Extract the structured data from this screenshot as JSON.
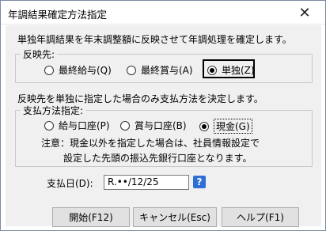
{
  "window": {
    "title": "年調結果確定方法指定",
    "close_glyph": "✕"
  },
  "intro_text": "単独年調結果を年末調整額に反映させて年調処理を確定します。",
  "reflect_group": {
    "legend": "反映先:",
    "options": [
      {
        "label": "最終給与(Q)",
        "selected": false
      },
      {
        "label": "最終賞与(A)",
        "selected": false
      },
      {
        "label": "単独(Z)",
        "selected": true
      }
    ]
  },
  "payment_intro": "反映先を単独に指定した場合のみ支払方法を決定します。",
  "payment_group": {
    "legend": "支払方法指定:",
    "options": [
      {
        "label": "給与口座(P)",
        "selected": false
      },
      {
        "label": "賞与口座(B)",
        "selected": false
      },
      {
        "label": "現金(G)",
        "selected": true
      }
    ],
    "note_line1": "注意：現金以外を指定した場合は、社員情報設定で",
    "note_line2": "設定した先頭の振込先銀行口座となります。"
  },
  "payment_date": {
    "label": "支払日(D):",
    "value": "R.••/12/25",
    "help_glyph": "?"
  },
  "buttons": {
    "start": "開始(F12)",
    "cancel": "キャンセル(Esc)",
    "help": "ヘルプ(F1)"
  },
  "colors": {
    "accent": "#2d6fd6",
    "dialog_bg": "#f0f0f0"
  }
}
